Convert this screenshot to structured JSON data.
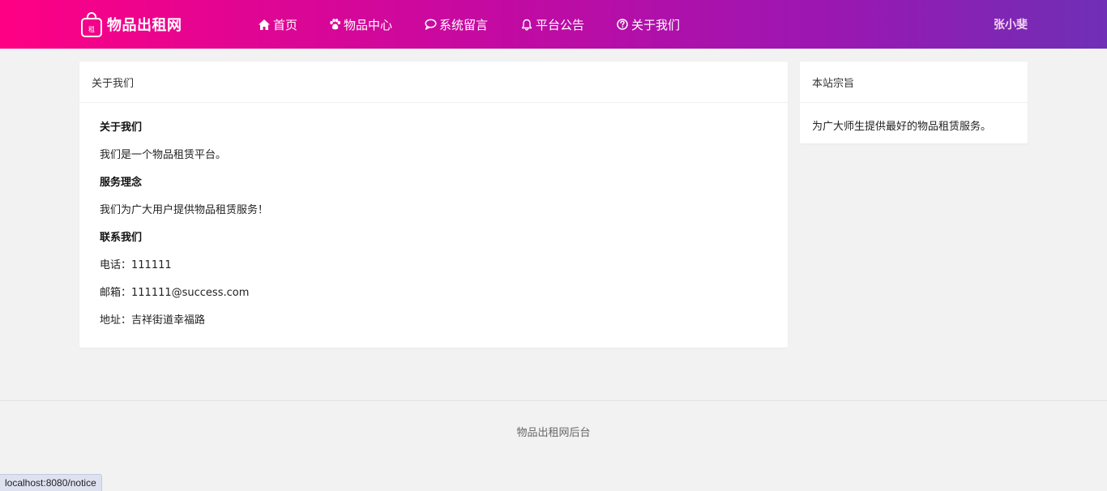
{
  "header": {
    "logo_text": "物品出租网",
    "logo_bag_char": "租",
    "nav": [
      {
        "label": "首页",
        "icon": "home-icon"
      },
      {
        "label": "物品中心",
        "icon": "paw-icon"
      },
      {
        "label": "系统留言",
        "icon": "comment-icon"
      },
      {
        "label": "平台公告",
        "icon": "bell-icon"
      },
      {
        "label": "关于我们",
        "icon": "question-circle-icon"
      }
    ],
    "user_name": "张小斐"
  },
  "main": {
    "title": "关于我们",
    "lines": [
      {
        "text": "关于我们",
        "bold": true
      },
      {
        "text": "我们是一个物品租赁平台。",
        "bold": false
      },
      {
        "text": "服务理念",
        "bold": true
      },
      {
        "text": "我们为广大用户提供物品租赁服务！",
        "bold": false
      },
      {
        "text": "联系我们",
        "bold": true
      },
      {
        "text": "电话：111111",
        "bold": false
      },
      {
        "text": "邮箱：111111@success.com",
        "bold": false
      },
      {
        "text": "地址：吉祥街道幸福路",
        "bold": false
      }
    ]
  },
  "side": {
    "title": "本站宗旨",
    "text": "为广大师生提供最好的物品租赁服务。"
  },
  "footer": {
    "text": "物品出租网后台"
  },
  "status_url": "localhost:8080/notice"
}
